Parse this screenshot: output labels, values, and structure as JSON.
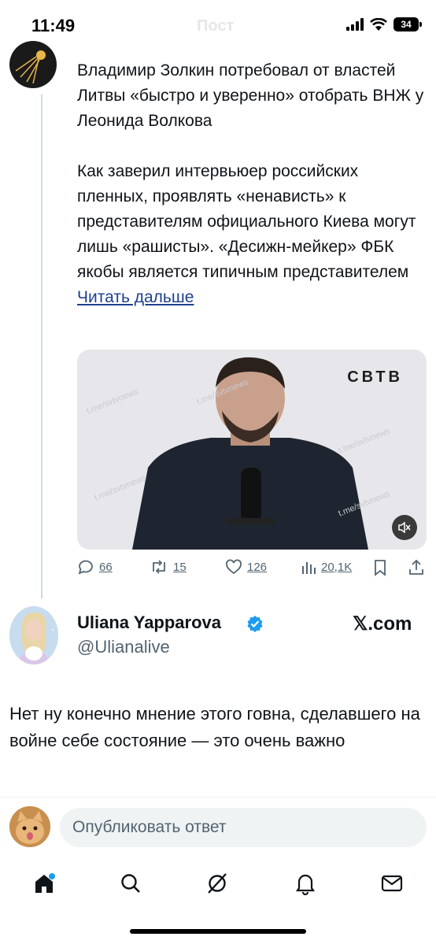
{
  "status_bar": {
    "time": "11:49",
    "battery": "34",
    "faded_header": "Пост"
  },
  "quoted_tweet": {
    "paragraph1": "Владимир Золкин потребовал от властей Литвы «быстро и уверенно» отобрать ВНЖ у Леонида Волкова",
    "paragraph2": "Как заверил интервьюер российских пленных, проявлять «ненависть» к представителям официального Киева могут лишь «рашисты». «Десижн-мейкер» ФБК якобы является типичным представителем",
    "read_more": "Читать дальше",
    "media": {
      "watermark": "t.me/svtvnews",
      "logo": "СВТВ"
    },
    "actions": {
      "replies": "66",
      "reposts": "15",
      "likes": "126",
      "views": "20,1K"
    }
  },
  "reply_tweet": {
    "name": "Uliana Yapparova",
    "handle": "@Ulianalive",
    "source": "𝕏.com",
    "text": "Нет ну конечно мнение этого говна, сделавшего на войне себе состояние — это очень важно"
  },
  "composer": {
    "placeholder": "Опубликовать ответ"
  },
  "tabs": [
    "home-icon",
    "search-icon",
    "grok-icon",
    "notifications-icon",
    "messages-icon"
  ],
  "colors": {
    "link": "#1d3f8f",
    "secondary": "#536471",
    "verified": "#1d9bf0"
  }
}
